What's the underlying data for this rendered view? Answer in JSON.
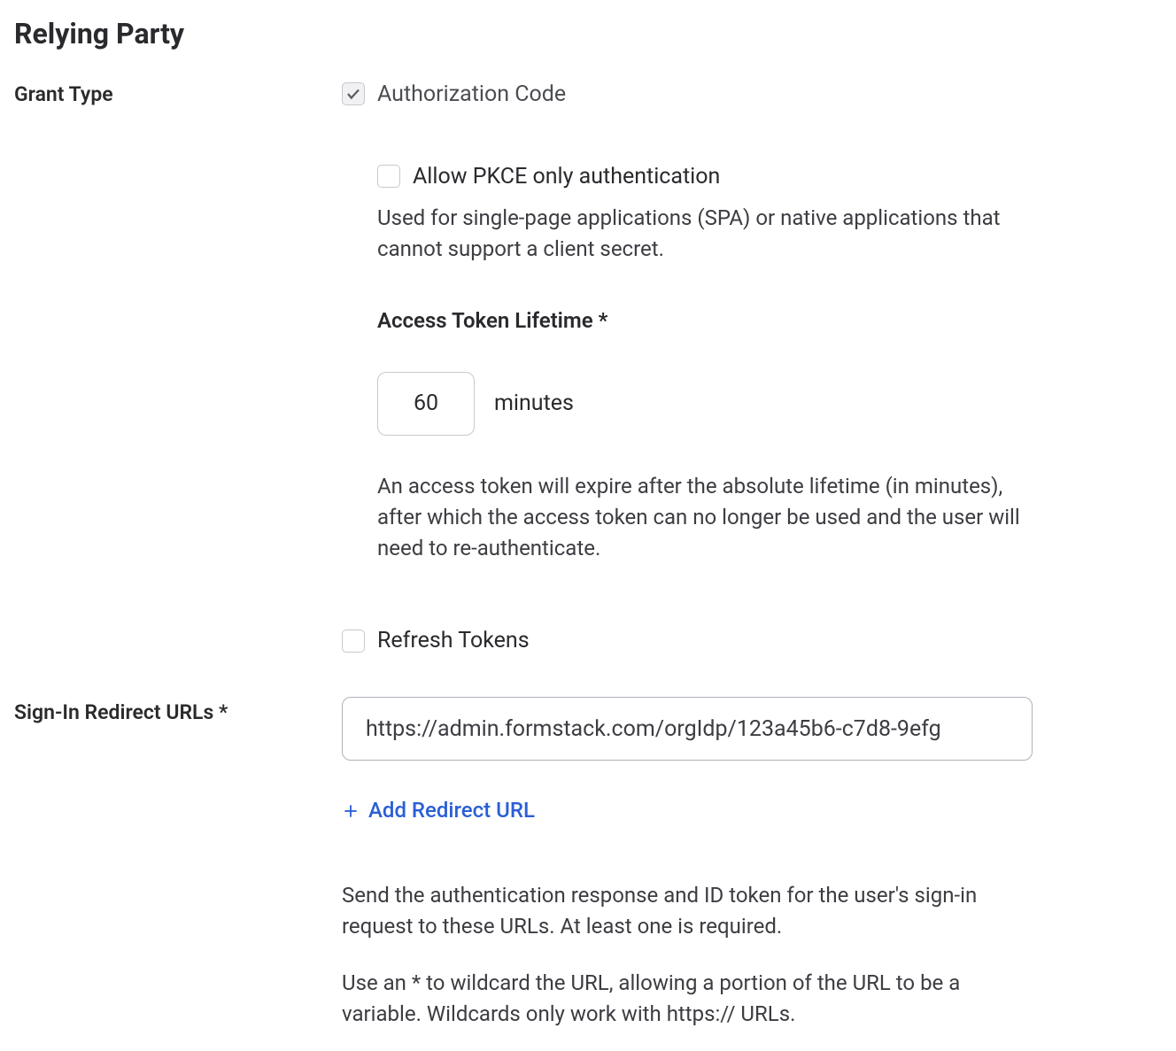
{
  "section_title": "Relying Party",
  "grant_type": {
    "label": "Grant Type",
    "auth_code_label": "Authorization Code",
    "auth_code_checked": true,
    "pkce": {
      "label": "Allow PKCE only authentication",
      "checked": false,
      "help": "Used for single-page applications (SPA) or native applications that cannot support a client secret."
    },
    "access_token": {
      "title": "Access Token Lifetime *",
      "value": "60",
      "unit": "minutes",
      "help": "An access token will expire after the absolute lifetime (in minutes), after which the access token can no longer be used and the user will need to re-authenticate."
    },
    "refresh_tokens": {
      "label": "Refresh Tokens",
      "checked": false
    }
  },
  "redirect": {
    "label": "Sign-In Redirect URLs *",
    "url_value": "https://admin.formstack.com/orgIdp/123a45b6-c7d8-9efg",
    "add_label": "Add Redirect URL",
    "help1": "Send the authentication response and ID token for the user's sign-in request to these URLs. At least one is required.",
    "help2": "Use an * to wildcard the URL, allowing a portion of the URL to be a variable. Wildcards only work with https:// URLs."
  }
}
